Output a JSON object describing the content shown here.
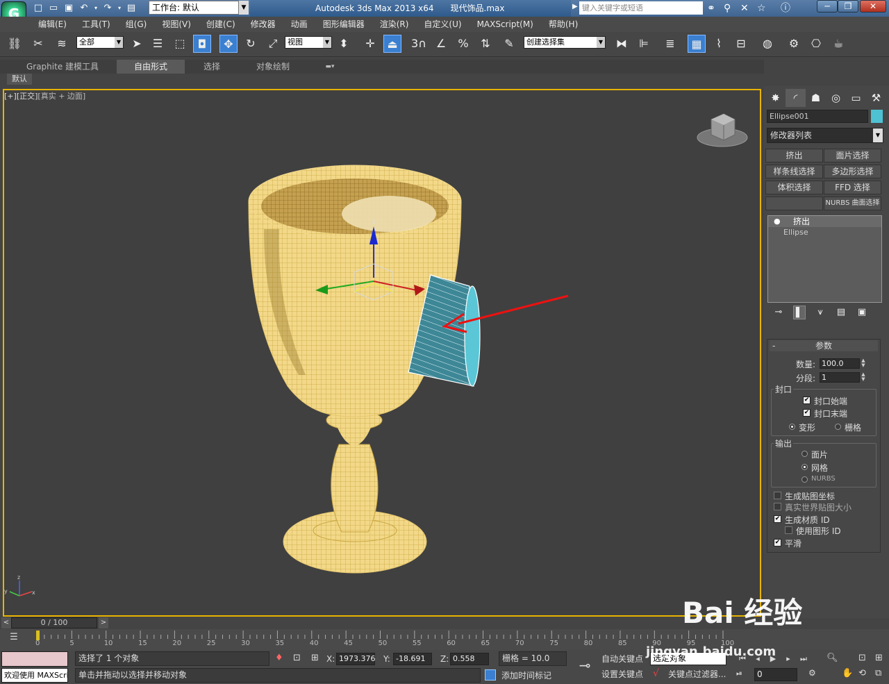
{
  "titlebar": {
    "workspace_label": "工作台: 默认",
    "app_name": "Autodesk 3ds Max  2013 x64",
    "file_name": "现代饰品.max",
    "search_placeholder": "键入关键字或短语"
  },
  "menu": [
    "编辑(E)",
    "工具(T)",
    "组(G)",
    "视图(V)",
    "创建(C)",
    "修改器",
    "动画",
    "图形编辑器",
    "渲染(R)",
    "自定义(U)",
    "MAXScript(M)",
    "帮助(H)"
  ],
  "toolbar": {
    "filter_value": "全部",
    "refcoord_value": "视图",
    "selset_value": "创建选择集",
    "snap_label": "3"
  },
  "ribbon": {
    "tabs": [
      "Graphite 建模工具",
      "自由形式",
      "选择",
      "对象绘制"
    ],
    "selected": "自由形式",
    "sub": "默认"
  },
  "viewport": {
    "label_plus": "[+]",
    "label_view": "[正交]",
    "label_mode": "[真实 + 边面]"
  },
  "command_panel": {
    "object_name": "Ellipse001",
    "object_color": "#4ec2d2",
    "modifier_list": "修改器列表",
    "mod_buttons": [
      "挤出",
      "面片选择",
      "样条线选择",
      "多边形选择",
      "体积选择",
      "FFD 选择",
      "",
      "NURBS 曲面选择"
    ],
    "stack": {
      "selected": "挤出",
      "base": "Ellipse"
    },
    "params": {
      "title": "参数",
      "amount_label": "数量:",
      "amount_value": "100.0",
      "segments_label": "分段:",
      "segments_value": "1",
      "capping_title": "封口",
      "cap_start": "封口始端",
      "cap_end": "封口末端",
      "morph": "变形",
      "grid": "栅格",
      "output_title": "输出",
      "out_patch": "面片",
      "out_mesh": "网格",
      "out_nurbs": "NURBS",
      "gen_map": "生成贴图坐标",
      "real_world": "真实世界贴图大小",
      "gen_matid": "生成材质 ID",
      "use_shape_id": "使用图形 ID",
      "smooth": "平滑"
    }
  },
  "timeline": {
    "frame_display": "0 / 100",
    "ticks": [
      "0",
      "5",
      "10",
      "15",
      "20",
      "25",
      "30",
      "35",
      "40",
      "45",
      "50",
      "55",
      "60",
      "65",
      "70",
      "75",
      "80",
      "85",
      "90",
      "95",
      "100"
    ]
  },
  "status": {
    "welcome": "欢迎使用 MAXScript。",
    "selected_text": "选择了 1 个对象",
    "prompt_text": "单击并拖动以选择并移动对象",
    "x_label": "X:",
    "x_value": "1973.376",
    "y_label": "Y:",
    "y_value": "-18.691",
    "z_label": "Z:",
    "z_value": "0.558",
    "grid_text": "栅格 = 10.0",
    "add_time_tag": "添加时间标记",
    "auto_key": "自动关键点",
    "set_key": "设置关键点",
    "key_mode_value": "选定对象",
    "key_filters": "关键点过滤器...",
    "current_frame": "0"
  },
  "watermark": {
    "brand": "Bai 经验",
    "url": "jingyan.baidu.com"
  }
}
